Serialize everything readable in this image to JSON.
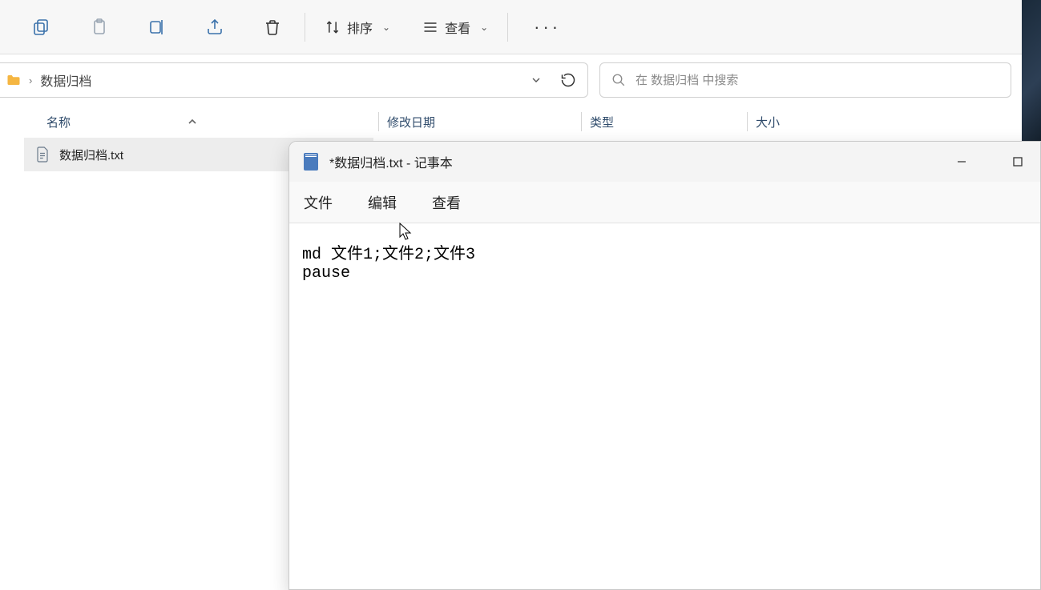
{
  "explorer": {
    "toolbar": {
      "sort_label": "排序",
      "view_label": "查看"
    },
    "breadcrumb": {
      "folder": "数据归档"
    },
    "search": {
      "placeholder": "在 数据归档 中搜索"
    },
    "columns": {
      "name": "名称",
      "modified": "修改日期",
      "type": "类型",
      "size": "大小"
    },
    "files": [
      {
        "name": "数据归档.txt"
      }
    ]
  },
  "notepad": {
    "title": "*数据归档.txt - 记事本",
    "menu": {
      "file": "文件",
      "edit": "编辑",
      "view": "查看"
    },
    "content": "md 文件1;文件2;文件3\npause"
  }
}
